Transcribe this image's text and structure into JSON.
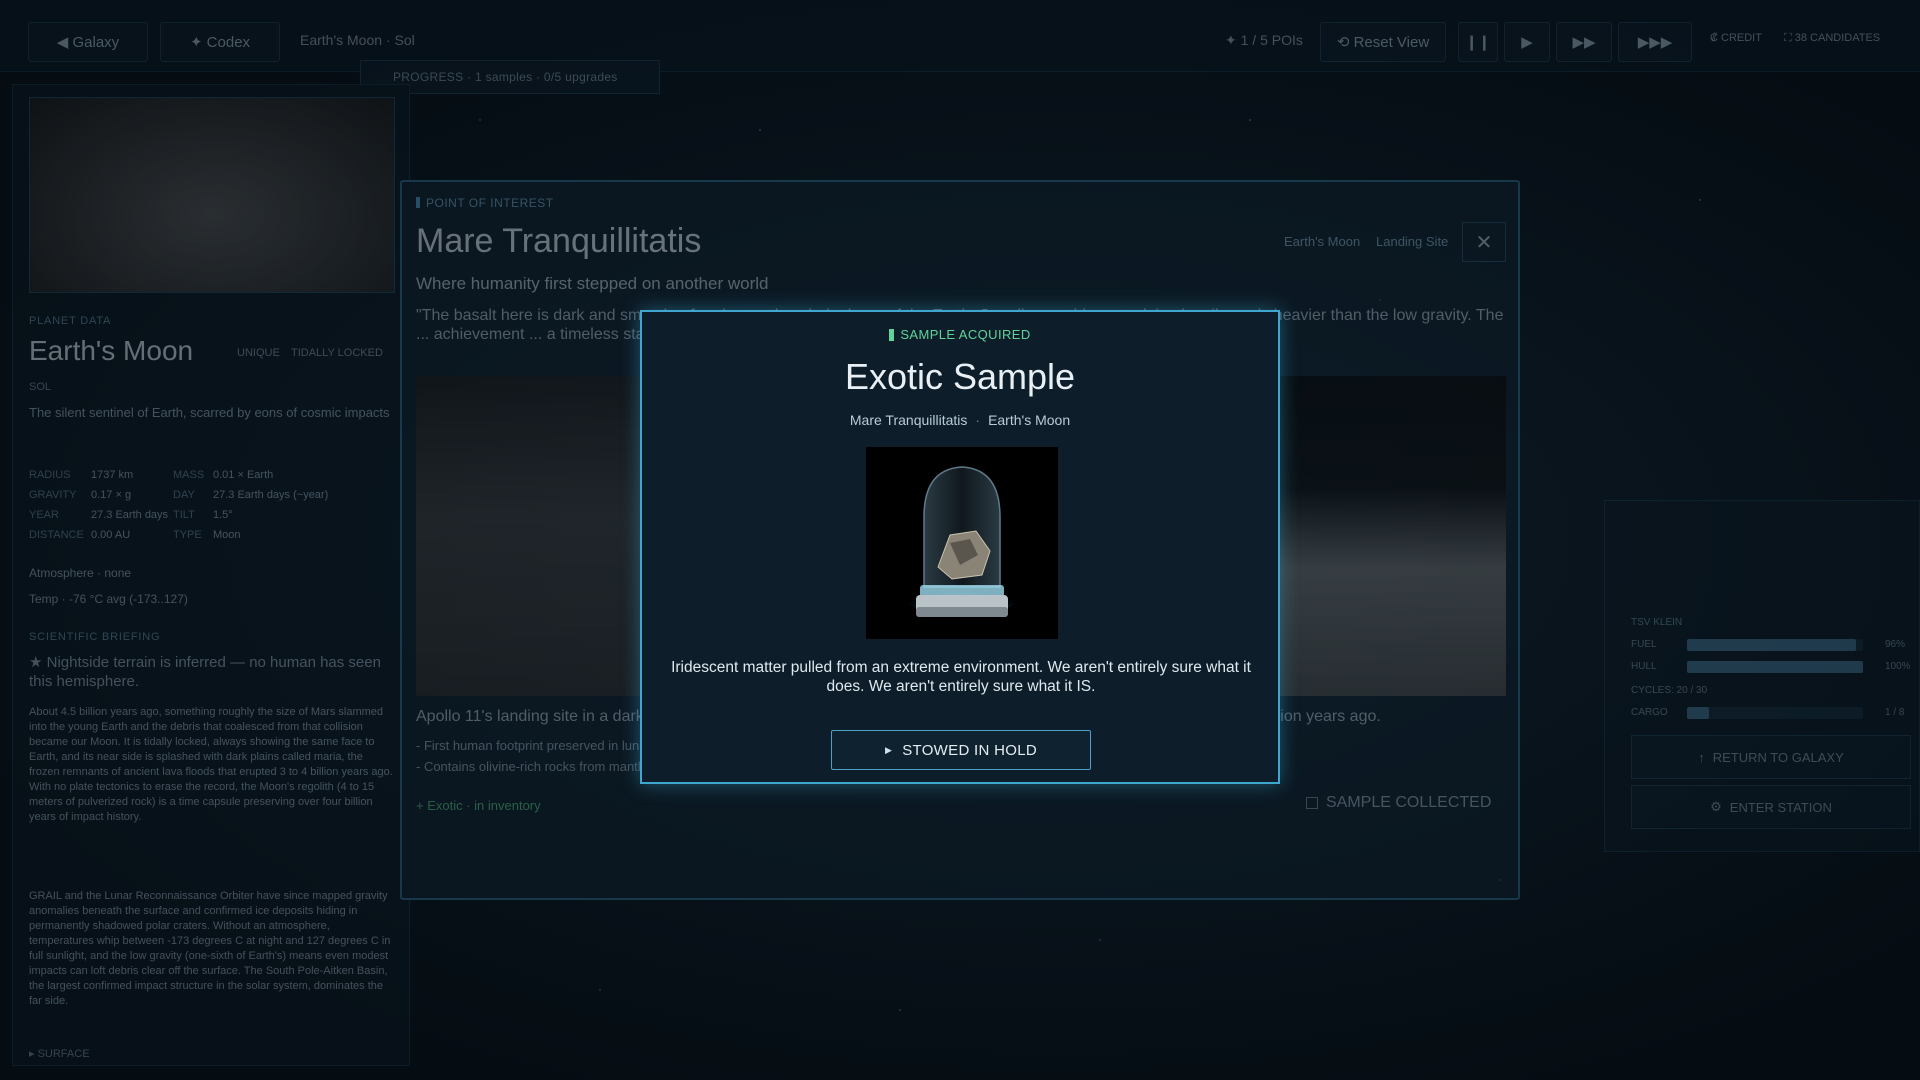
{
  "topbar": {
    "galaxy_label": "◀ Galaxy",
    "codex_label": "✦ Codex",
    "location": "Earth's Moon · Sol",
    "pois": "✦ 1 / 5 POIs",
    "reset_label": "⟲ Reset View",
    "credit": "₡ CREDIT",
    "candidates": "⛶ 38 CANDIDATES",
    "progress": "PROGRESS · 1 samples · 0/5 upgrades"
  },
  "sidebar": {
    "planet_data_label": "PLANET DATA",
    "planet_name": "Earth's Moon",
    "chip_unique": "Unique",
    "chip_locked": "TIDALLY LOCKED",
    "system": "SOL",
    "tagline": "The silent sentinel of Earth, scarred by eons of cosmic impacts",
    "stats": [
      {
        "k": "RADIUS",
        "v": "1737 km",
        "k2": "MASS",
        "v2": "0.01 × Earth"
      },
      {
        "k": "GRAVITY",
        "v": "0.17 × g",
        "k2": "DAY",
        "v2": "27.3 Earth days (~year)"
      },
      {
        "k": "YEAR",
        "v": "27.3 Earth days",
        "k2": "TILT",
        "v2": "1.5°"
      },
      {
        "k": "DISTANCE",
        "v": "0.00 AU",
        "k2": "TYPE",
        "v2": "Moon"
      }
    ],
    "atmosphere": "Atmosphere · none",
    "temp": "Temp · -76 °C avg (-173..127)",
    "briefing_label": "SCIENTIFIC BRIEFING",
    "briefing_head": "★ Nightside terrain is inferred — no human has seen this hemisphere.",
    "briefing_body": "About 4.5 billion years ago, something roughly the size of Mars slammed into the young Earth and the debris that coalesced from that collision became our Moon. It is tidally locked, always showing the same face to Earth, and its near side is splashed with dark plains called maria, the frozen remnants of ancient lava floods that erupted 3 to 4 billion years ago. With no plate tectonics to erase the record, the Moon's regolith (4 to 15 meters of pulverized rock) is a time capsule preserving over four billion years of impact history.",
    "briefing_body2": "GRAIL and the Lunar Reconnaissance Orbiter have since mapped gravity anomalies beneath the surface and confirmed ice deposits hiding in permanently shadowed polar craters. Without an atmosphere, temperatures whip between -173 degrees C at night and 127 degrees C in full sunlight, and the low gravity (one-sixth of Earth's) means even modest impacts can loft debris clear off the surface. The South Pole-Aitken Basin, the largest confirmed impact structure in the solar system, dominates the far side.",
    "footer": "▸ SURFACE"
  },
  "ship": {
    "name": "TSV KLEIN",
    "fuel_label": "FUEL",
    "fuel_val": "96%",
    "fuel": 0.96,
    "hull_label": "HULL",
    "hull_val": "100%",
    "hull": 1.0,
    "cycles": "CYCLES: 20 / 30",
    "cargo_label": "CARGO",
    "cargo_val": "1 / 8",
    "cargo": 0.125,
    "return_label": "RETURN TO GALAXY",
    "station_label": "ENTER STATION"
  },
  "poi": {
    "kicker": "POINT OF INTEREST",
    "title": "Mare Tranquillitatis",
    "tag_moon": "Earth's Moon",
    "tag_site": "Landing Site",
    "subtitle": "Where humanity first stepped on another world",
    "quote": "\"The basalt here is dark and smooth... forming on the whole the ... of the Earth. Standing on this gray plain, the silence is heavier than the low gravity. The ... achievement ... a timeless stage where history happened, now reduced to a quiet ...\"",
    "desc": "Apollo 11's landing site in a dark basaltic plain. The region was formed by the ancient lava flows that filled the basin 3.7 billion years ago.",
    "bullet1": "- First human footprint preserved in lunar dust",
    "bullet2": "- Contains olivine-rich rocks from mantle material",
    "inventory": "+ Exotic · in inventory",
    "collected": "SAMPLE COLLECTED"
  },
  "modal": {
    "kicker": "SAMPLE ACQUIRED",
    "title": "Exotic Sample",
    "loc_site": "Mare Tranquillitatis",
    "loc_body": "Earth's Moon",
    "desc": "Iridescent matter pulled from an extreme environment. We aren't entirely sure what it does. We aren't entirely sure what it IS.",
    "button": "STOWED IN HOLD"
  }
}
